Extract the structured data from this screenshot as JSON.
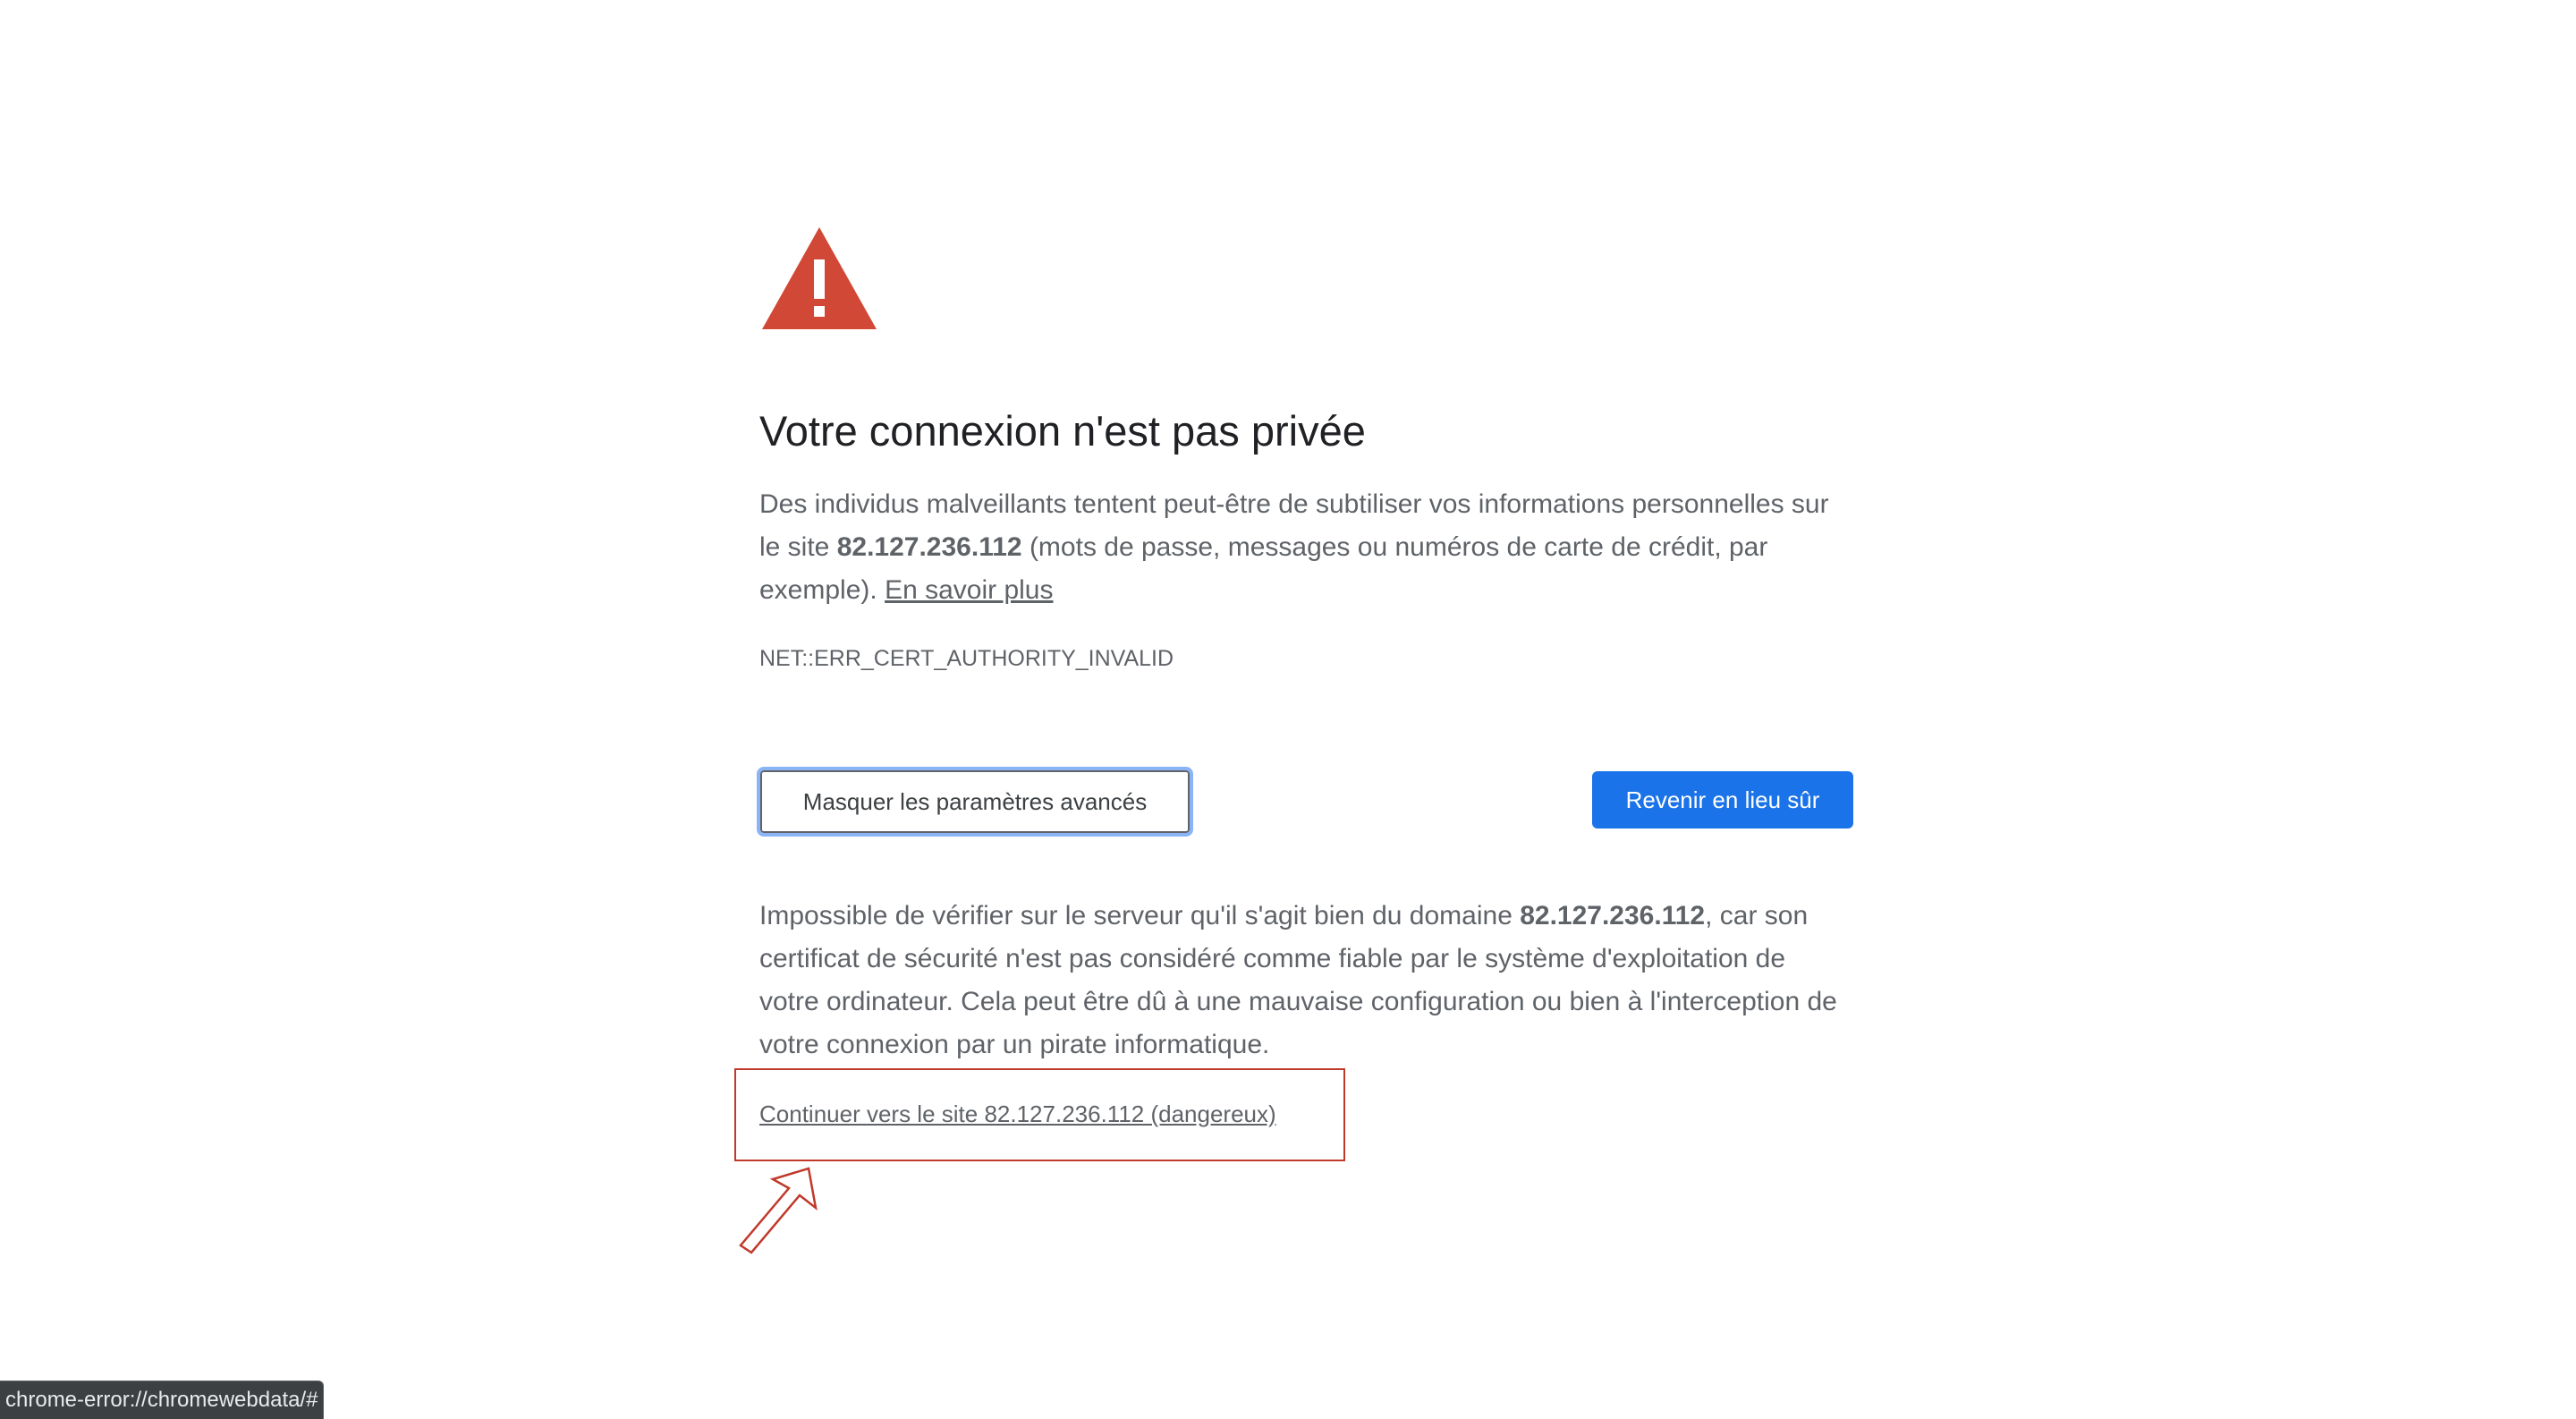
{
  "interstitial": {
    "title": "Votre connexion n'est pas privée",
    "description": {
      "part1": "Des individus malveillants tentent peut-être de subtiliser vos informations personnelles sur le site ",
      "host": "82.127.236.112",
      "part2": " (mots de passe, messages ou numéros de carte de crédit, par exemple). ",
      "learn_more": "En savoir plus"
    },
    "error_code": "NET::ERR_CERT_AUTHORITY_INVALID",
    "advanced_button": "Masquer les paramètres avancés",
    "back_button": "Revenir en lieu sûr",
    "details": {
      "part1": "Impossible de vérifier sur le serveur qu'il s'agit bien du domaine ",
      "host": "82.127.236.112",
      "part2": ", car son certificat de sécurité n'est pas considéré comme fiable par le système d'exploitation de votre ordinateur. Cela peut être dû à une mauvaise configuration ou bien à l'interception de votre connexion par un pirate informatique."
    },
    "proceed_link": "Continuer vers le site 82.127.236.112 (dangereux)"
  },
  "annotation": {
    "box_color": "#c0392b",
    "arrow_icon": "arrow-up-right-outline"
  },
  "icons": {
    "warning": "warning-triangle-icon"
  },
  "colors": {
    "warning_red": "#d14836",
    "primary_blue": "#1a73e8",
    "focus_ring": "#8ab4f8"
  },
  "status_bar": {
    "url": "chrome-error://chromewebdata/#"
  }
}
